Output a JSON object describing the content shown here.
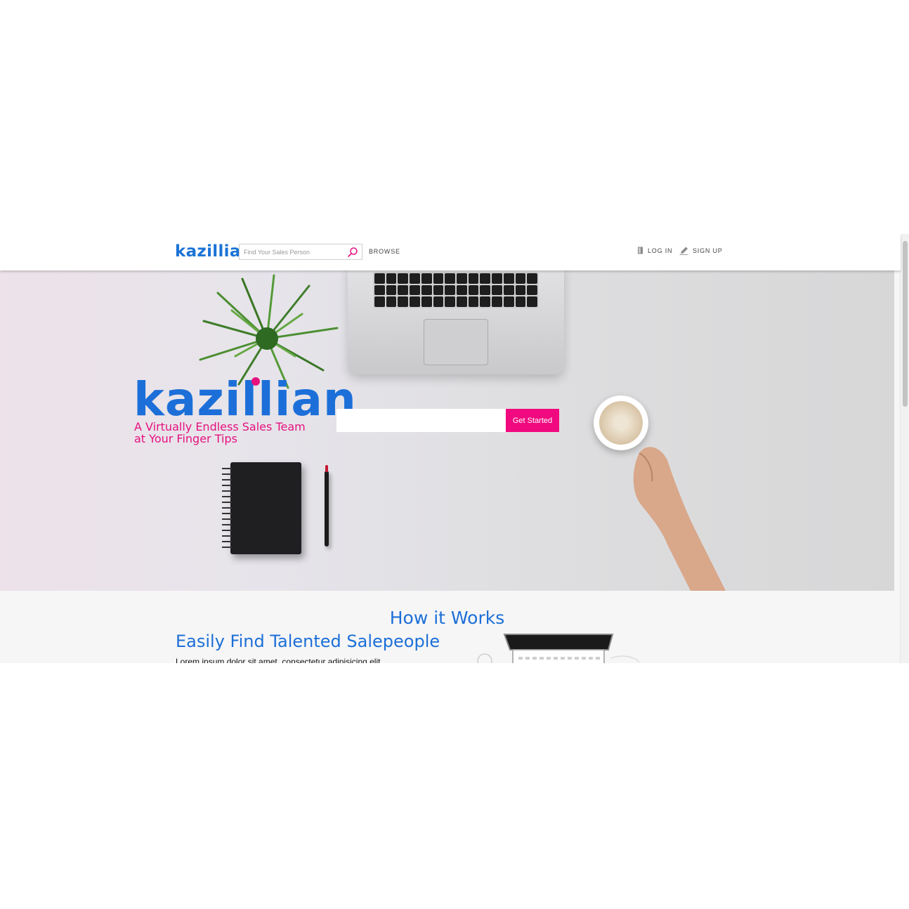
{
  "nav": {
    "logo": "kazillian",
    "search_placeholder": "Find Your Sales Person",
    "browse_label": "BROWSE",
    "login_label": "LOG IN",
    "signup_label": "SIGN UP"
  },
  "hero": {
    "brand": "kazillian",
    "tagline_line1": "A Virtually Endless Sales Team",
    "tagline_line2": "at Your Finger Tips",
    "cta_label": "Get Started",
    "search_value": ""
  },
  "how_it_works": {
    "title": "How it Works",
    "feature_heading": "Easily Find Talented Salepeople",
    "feature_text": "Lorem ipsum dolor sit amet, consectetur adipisicing elit"
  },
  "colors": {
    "brand_blue": "#1c6fd8",
    "accent_pink": "#f0097f"
  },
  "icons": {
    "search": "search-icon",
    "login": "door-icon",
    "signup": "pencil-icon"
  }
}
